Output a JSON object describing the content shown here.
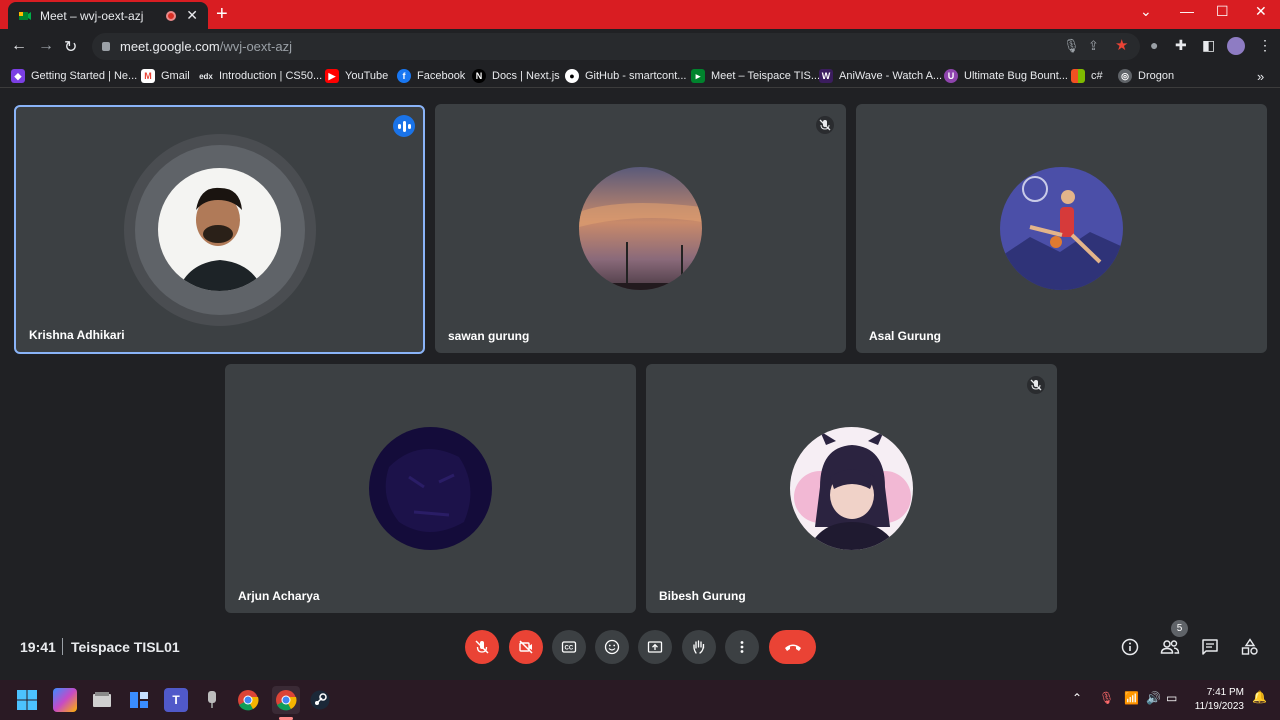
{
  "browser": {
    "tab_title": "Meet – wvj-oext-azj",
    "url_host": "meet.google.com",
    "url_path": "/wvj-oext-azj",
    "bookmarks": [
      {
        "label": "Getting Started | Ne...",
        "icon": "shield-icon"
      },
      {
        "label": "Gmail",
        "icon": "gmail-icon"
      },
      {
        "label": "Introduction | CS50...",
        "icon": "edx-icon"
      },
      {
        "label": "YouTube",
        "icon": "youtube-icon"
      },
      {
        "label": "Facebook",
        "icon": "facebook-icon"
      },
      {
        "label": "Docs | Next.js",
        "icon": "nextjs-icon"
      },
      {
        "label": "GitHub - smartcont...",
        "icon": "github-icon"
      },
      {
        "label": "Meet – Teispace TIS...",
        "icon": "meet-icon"
      },
      {
        "label": "AniWave - Watch A...",
        "icon": "aniwave-icon"
      },
      {
        "label": "Ultimate Bug Bount...",
        "icon": "bug-icon"
      },
      {
        "label": "c#",
        "icon": "windows-icon"
      },
      {
        "label": "Drogon",
        "icon": "globe-icon"
      }
    ],
    "more_bookmarks": "»"
  },
  "participants": [
    {
      "name": "Krishna Adhikari",
      "speaking": true,
      "muted": false
    },
    {
      "name": "sawan gurung",
      "speaking": false,
      "muted": true
    },
    {
      "name": "Asal Gurung",
      "speaking": false,
      "muted": false
    },
    {
      "name": "Arjun Acharya",
      "speaking": false,
      "muted": false
    },
    {
      "name": "Bibesh Gurung",
      "speaking": false,
      "muted": true
    }
  ],
  "meeting": {
    "time": "19:41",
    "separator": "|",
    "name": "Teispace TISL01",
    "participant_count": "5"
  },
  "taskbar": {
    "time": "7:41 PM",
    "date": "11/19/2023"
  },
  "colors": {
    "tab_bar": "#d91d22",
    "tile": "#3c4043",
    "active_border": "#8ab4f8",
    "danger": "#ea4335",
    "speaking": "#1a73e8"
  }
}
